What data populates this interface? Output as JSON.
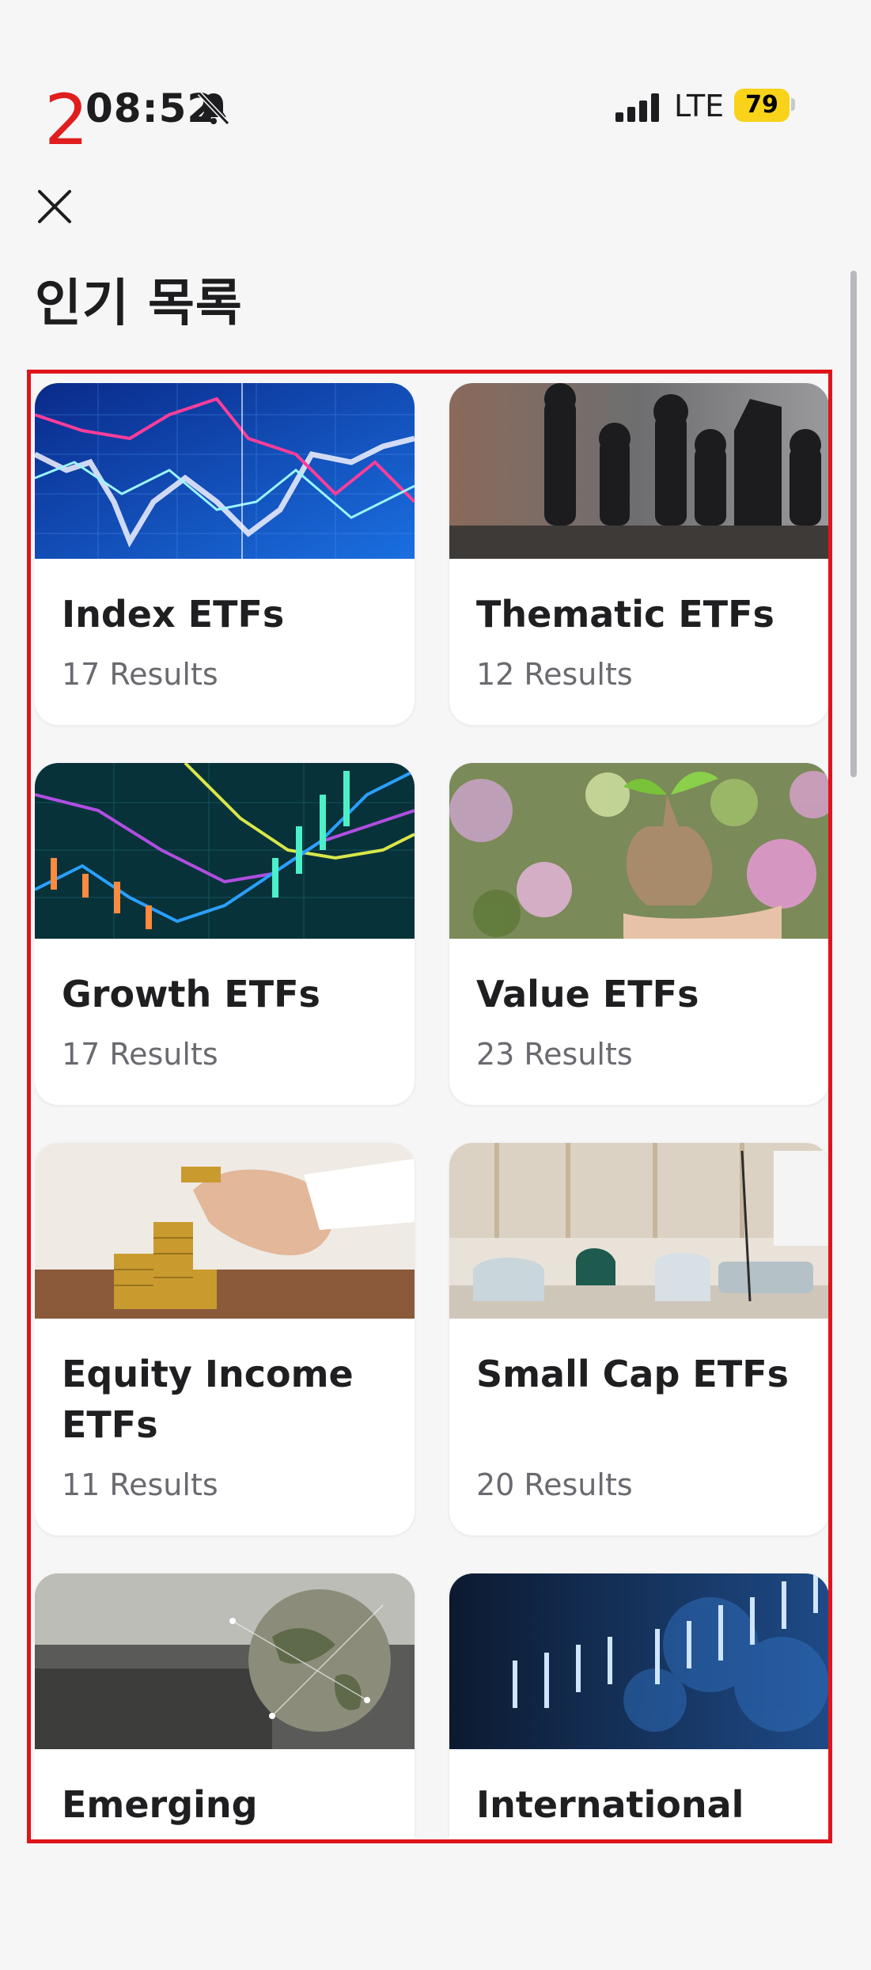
{
  "annotation": {
    "step_number": "2",
    "color": "#e01e1e"
  },
  "status_bar": {
    "time": "08:52",
    "network": "LTE",
    "battery": "79",
    "battery_color": "#f8d31a",
    "icons": [
      "bell-slash-icon",
      "signal-icon"
    ]
  },
  "header": {
    "close_icon": "close-icon",
    "title": "인기 목록"
  },
  "cards": [
    {
      "title": "Index ETFs",
      "count": "17 Results",
      "image": "stock-chart-photo"
    },
    {
      "title": "Thematic ETFs",
      "count": "12 Results",
      "image": "chess-pieces-photo"
    },
    {
      "title": "Growth ETFs",
      "count": "17 Results",
      "image": "candlestick-chart-photo"
    },
    {
      "title": "Value ETFs",
      "count": "23 Results",
      "image": "money-bag-plant-photo"
    },
    {
      "title": "Equity Income ETFs",
      "count": "11 Results",
      "image": "coin-stacks-photo"
    },
    {
      "title": "Small Cap ETFs",
      "count": "20 Results",
      "image": "office-lounge-photo"
    },
    {
      "title": "Emerging Markets ETFs",
      "count": "",
      "image": "globe-photo"
    },
    {
      "title": "International ETFs",
      "count": "",
      "image": "world-map-chart-photo"
    }
  ],
  "colors": {
    "highlight_border": "#e0141b",
    "page_bg": "#f6f6f7",
    "card_bg": "#ffffff"
  }
}
